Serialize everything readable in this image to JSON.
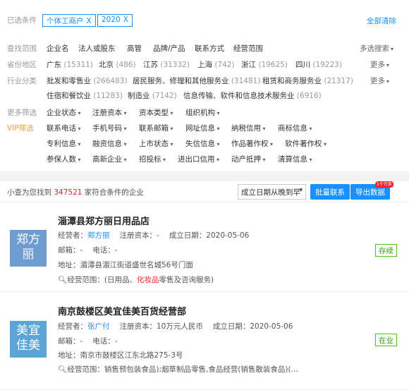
{
  "selected": {
    "label": "已选条件",
    "tags": [
      "个体工商户",
      "2020"
    ],
    "remove_glyph": "X",
    "clear_all": "全部清除"
  },
  "filters": {
    "scope": {
      "label": "查找范围",
      "options": [
        "企业名",
        "法人或股东",
        "高管",
        "品牌/产品",
        "联系方式",
        "经营范围"
      ],
      "more": "多选搜索"
    },
    "province": {
      "label": "省份地区",
      "options": [
        {
          "name": "广东",
          "count": "(15311)"
        },
        {
          "name": "北京",
          "count": "(486)"
        },
        {
          "name": "江苏",
          "count": "(31332)"
        },
        {
          "name": "上海",
          "count": "(742)"
        },
        {
          "name": "浙江",
          "count": "(19625)"
        },
        {
          "name": "四川",
          "count": "(19223)"
        }
      ],
      "more": "更多"
    },
    "industry": {
      "label": "行业分类",
      "options": [
        {
          "name": "批发和零售业",
          "count": "(266483)"
        },
        {
          "name": "居民服务、修理和其他服务业",
          "count": "(31481)"
        },
        {
          "name": "租赁和商务服务业",
          "count": "(21317)"
        },
        {
          "name": "住宿和餐饮业",
          "count": "(11283)"
        },
        {
          "name": "制造业",
          "count": "(7142)"
        },
        {
          "name": "信息传输、软件和信息技术服务业",
          "count": "(6916)"
        }
      ],
      "more": "更多"
    },
    "more_filter": {
      "label": "更多筛选",
      "options": [
        "企业状态",
        "注册资本",
        "资本类型",
        "组织机构"
      ]
    },
    "vip": {
      "label": "VIP筛选",
      "row1": [
        "联系电话",
        "手机号码",
        "联系邮箱",
        "网址信息",
        "纳税信用",
        "商标信息"
      ],
      "row2": [
        "专利信息",
        "融资信息",
        "上市状态",
        "失信信息",
        "作品著作权",
        "软件著作权"
      ],
      "row3": [
        "参保人数",
        "高新企业",
        "招投标",
        "进出口信用",
        "动产抵押",
        "清算信息"
      ]
    }
  },
  "results": {
    "prefix": "小查为您找到",
    "count": "347521",
    "suffix": "家符合条件的企业",
    "sort": "成立日期从晚到早",
    "batch_contact": "批量联系",
    "export": "导出数据",
    "export_badge": "1千万条"
  },
  "companies": [
    {
      "logo": [
        "郑方",
        "丽"
      ],
      "name": "淄潭县郑方丽日用品店",
      "rep_label": "经营者：",
      "rep": "郑方丽",
      "capital_label": "注册资本：",
      "capital": "-",
      "date_label": "成立日期：",
      "date": "2020-05-06",
      "email_label": "邮箱：",
      "email": "-",
      "phone_label": "电话：",
      "phone": "-",
      "addr_label": "地址：",
      "addr": "湄潭县湄江街道盛世名城56号门面",
      "scope_label": "经营范围：",
      "scope_pre": "(日用品、",
      "scope_hl": "化妆品",
      "scope_post": "零售及咨询服务)",
      "status": "存续"
    },
    {
      "logo": [
        "美宜",
        "佳美"
      ],
      "name": "南京鼓楼区美宜佳美百货经营部",
      "rep_label": "经营者：",
      "rep": "张广付",
      "capital_label": "注册资本：",
      "capital": "10万元人民币",
      "date_label": "成立日期：",
      "date": "2020-05-06",
      "email_label": "邮箱：",
      "email": "-",
      "phone_label": "电话：",
      "phone": "-",
      "addr_label": "地址：",
      "addr": "南京市鼓楼区江东北路275-3号",
      "scope_label": "经营范围：",
      "scope_pre": "销售预包装食品);烟草制品零售,食品经营(销售散装食品)(...",
      "scope_hl": "",
      "scope_post": "",
      "status": "在业"
    }
  ]
}
